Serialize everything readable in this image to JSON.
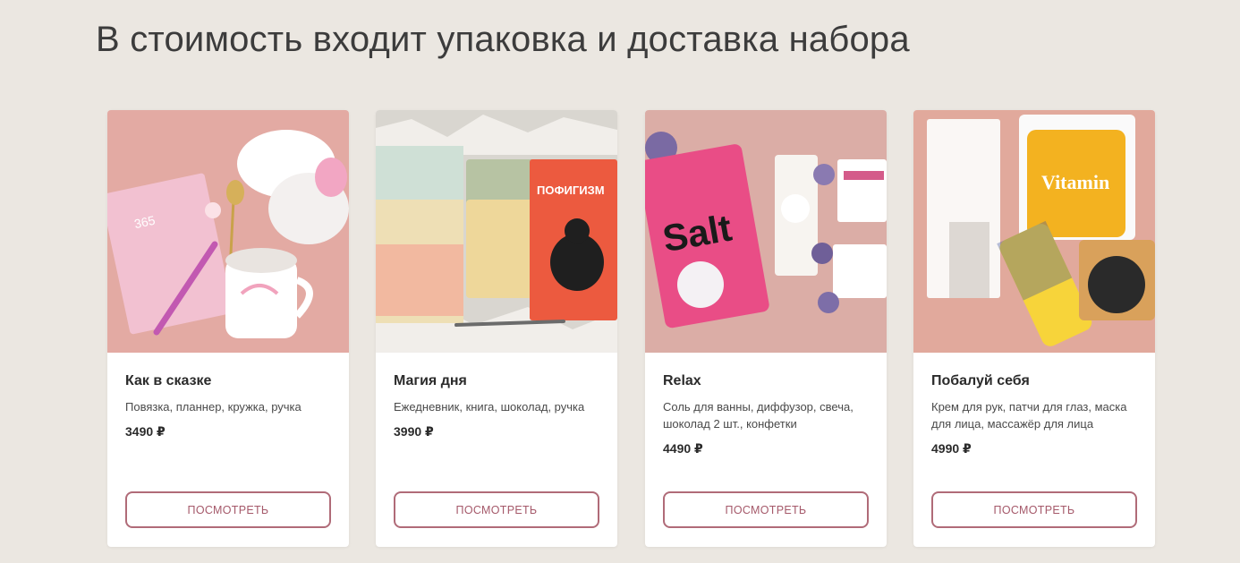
{
  "section": {
    "title": "В стоимость входит упаковка и доставка набора"
  },
  "cards": [
    {
      "title": "Как в сказке",
      "description": "Повязка, планнер, кружка, ручка",
      "price": "3490 ₽",
      "button_label": "ПОСМОТРЕТЬ",
      "image_text": "365"
    },
    {
      "title": "Магия дня",
      "description": "Ежедневник, книга, шоколад, ручка",
      "price": "3990 ₽",
      "button_label": "ПОСМОТРЕТЬ",
      "image_text": "ПОФИГИЗМ"
    },
    {
      "title": "Relax",
      "description": "Соль для ванны, диффузор, свеча, шоколад 2 шт., конфетки",
      "price": "4490 ₽",
      "button_label": "ПОСМОТРЕТЬ",
      "image_text": "Salt"
    },
    {
      "title": "Побалуй себя",
      "description": "Крем для рук, патчи для глаз, маска для лица, массажёр для лица",
      "price": "4990 ₽",
      "button_label": "ПОСМОТРЕТЬ",
      "image_text": "Vitamin"
    }
  ],
  "colors": {
    "background": "#ebe7e1",
    "card": "#ffffff",
    "button_border": "#b06b78",
    "button_text": "#a5596a"
  }
}
